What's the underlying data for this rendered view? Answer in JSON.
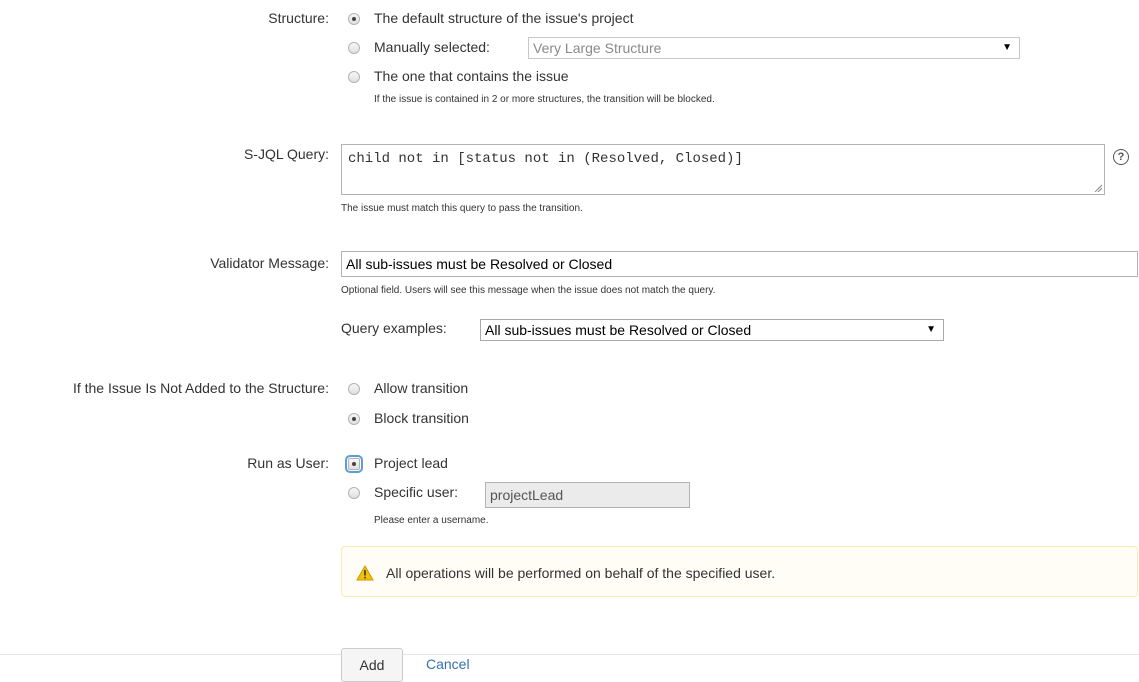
{
  "structure": {
    "label": "Structure:",
    "options": [
      {
        "label": "The default structure of the issue's project",
        "checked": true
      },
      {
        "label": "Manually selected:",
        "checked": false
      },
      {
        "label": "The one that contains the issue",
        "checked": false
      }
    ],
    "select_value": "Very Large Structure",
    "hint": "If the issue is contained in 2 or more structures, the transition will be blocked."
  },
  "sjql": {
    "label": "S-JQL Query:",
    "value": "child not in [status not in (Resolved, Closed)]",
    "hint": "The issue must match this query to pass the transition.",
    "help_glyph": "?"
  },
  "validator": {
    "label": "Validator Message:",
    "value": "All sub-issues must be Resolved or Closed",
    "hint": "Optional field. Users will see this message when the issue does not match the query.",
    "examples_label": "Query examples:",
    "examples_value": "All sub-issues must be Resolved or Closed"
  },
  "not_added": {
    "label": "If the Issue Is Not Added to the Structure:",
    "options": [
      {
        "label": "Allow transition",
        "checked": false
      },
      {
        "label": "Block transition",
        "checked": true
      }
    ]
  },
  "run_as": {
    "label": "Run as User:",
    "options": [
      {
        "label": "Project lead",
        "checked": true
      },
      {
        "label": "Specific user:",
        "checked": false
      }
    ],
    "user_value": "projectLead",
    "hint": "Please enter a username.",
    "warning": "All operations will be performed on behalf of the specified user."
  },
  "actions": {
    "add_label": "Add",
    "cancel_label": "Cancel"
  },
  "colors": {
    "link": "#3572b0",
    "warning_bg": "#fffdf6",
    "warning_border": "#ffeaae",
    "warning_icon": "#f2c200"
  },
  "icons": [
    "help-icon",
    "warning-icon",
    "dropdown-arrow-icon"
  ]
}
